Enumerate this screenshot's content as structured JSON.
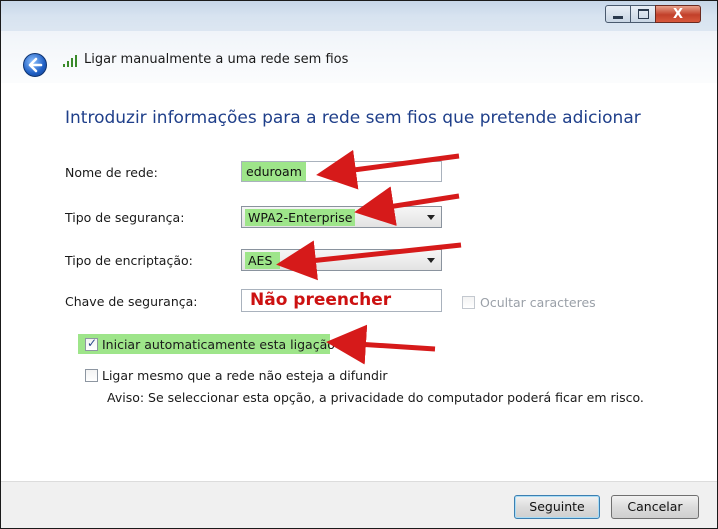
{
  "window": {
    "title": "Ligar manualmente a uma rede sem fios",
    "controls": {
      "minimize": "minimize",
      "maximize": "maximize",
      "close": "X"
    }
  },
  "heading": "Introduzir informações para a rede sem fios que pretende adicionar",
  "form": {
    "network_name": {
      "label": "Nome de rede:",
      "value": "eduroam"
    },
    "security_type": {
      "label": "Tipo de segurança:",
      "value": "WPA2-Enterprise"
    },
    "encryption_type": {
      "label": "Tipo de encriptação:",
      "value": "AES"
    },
    "security_key": {
      "label": "Chave de segurança:",
      "value": "Não preencher",
      "hide_label": "Ocultar caracteres"
    }
  },
  "options": {
    "auto_start": {
      "label": "Iniciar automaticamente esta ligação",
      "checked": true
    },
    "connect_even": {
      "label": "Ligar mesmo que a rede não esteja a difundir",
      "checked": false
    },
    "warning": "Aviso: Se seleccionar esta opção, a privacidade do computador poderá ficar em risco."
  },
  "buttons": {
    "next": "Seguinte",
    "cancel": "Cancelar"
  },
  "colors": {
    "highlight": "#9ee58a",
    "arrow": "#d61a1a",
    "heading": "#1f3f8a",
    "annotation_text": "#cc1111"
  },
  "icons": [
    "back-arrow-icon",
    "wifi-signal-icon",
    "dropdown-arrow-icon",
    "checkbox-icon"
  ]
}
